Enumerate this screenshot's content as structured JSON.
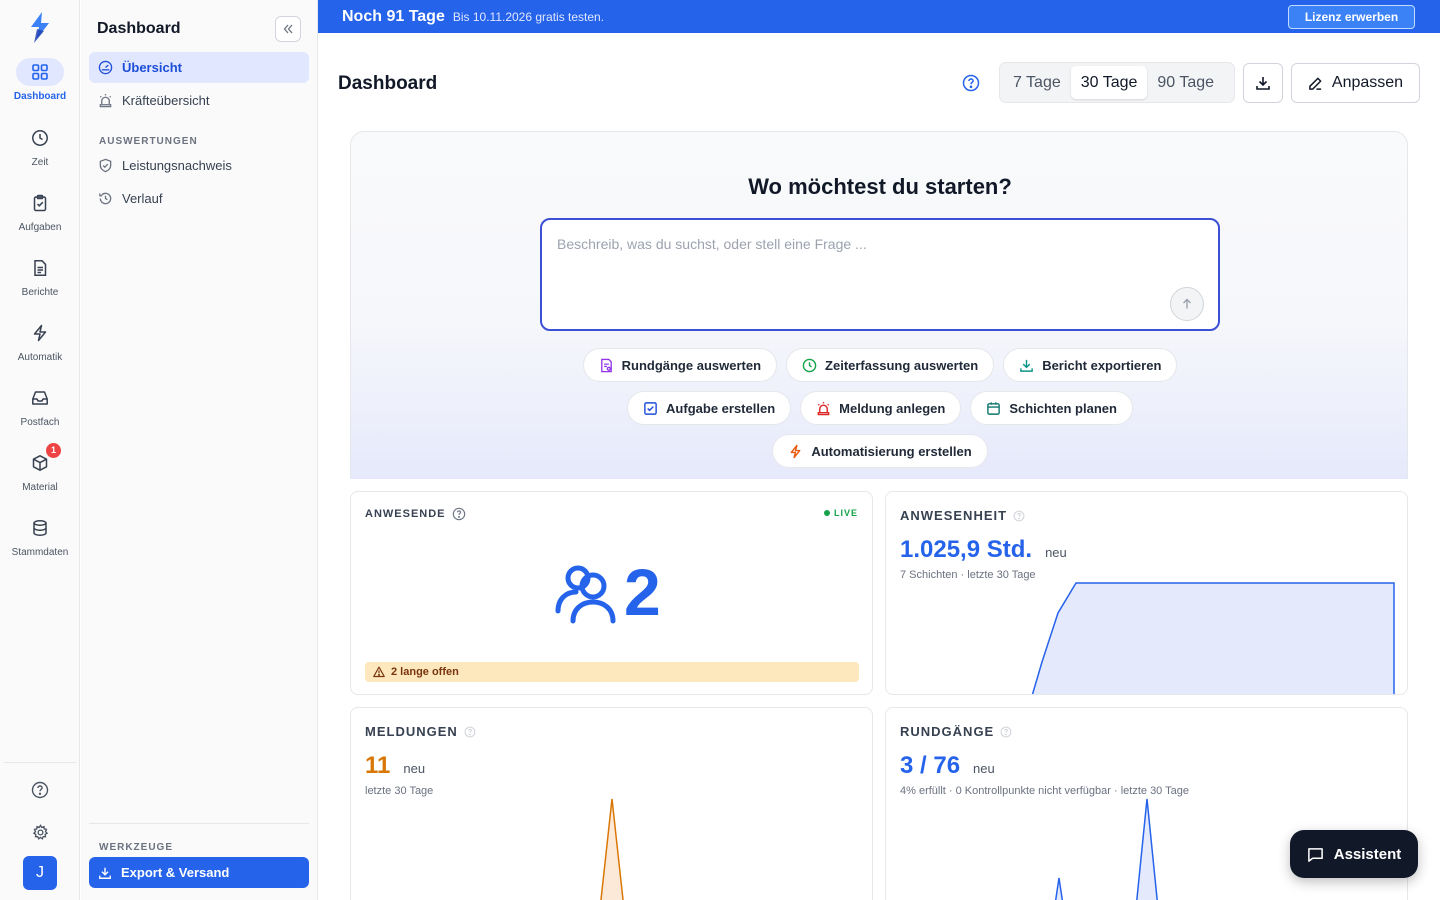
{
  "rail": {
    "items": [
      {
        "label": "Dashboard",
        "icon": "dashboard-grid-icon",
        "active": true
      },
      {
        "label": "Zeit",
        "icon": "clock-icon"
      },
      {
        "label": "Aufgaben",
        "icon": "clipboard-check-icon"
      },
      {
        "label": "Berichte",
        "icon": "document-icon"
      },
      {
        "label": "Automatik",
        "icon": "lightning-icon"
      },
      {
        "label": "Postfach",
        "icon": "inbox-icon"
      },
      {
        "label": "Material",
        "icon": "package-icon",
        "badge": "1"
      },
      {
        "label": "Stammdaten",
        "icon": "database-icon"
      }
    ],
    "avatar": "J"
  },
  "sidebar": {
    "title": "Dashboard",
    "items": [
      {
        "label": "Übersicht",
        "active": true
      },
      {
        "label": "Kräfteübersicht"
      }
    ],
    "section_auswertungen": "AUSWERTUNGEN",
    "auswertungen": [
      {
        "label": "Leistungsnachweis"
      },
      {
        "label": "Verlauf"
      }
    ],
    "section_werkzeuge": "WERKZEUGE",
    "export_label": "Export & Versand"
  },
  "banner": {
    "headline": "Noch 91 Tage",
    "subtext": "Bis 10.11.2026 gratis testen.",
    "button": "Lizenz erwerben"
  },
  "header": {
    "title": "Dashboard",
    "ranges": [
      "7 Tage",
      "30 Tage",
      "90 Tage"
    ],
    "active_range": "30 Tage",
    "customize": "Anpassen"
  },
  "hero": {
    "title": "Wo möchtest du starten?",
    "placeholder": "Beschreib, was du suchst, oder stell eine Frage ...",
    "chips": [
      [
        "Rundgänge auswerten",
        "Zeiterfassung auswerten",
        "Bericht exportieren"
      ],
      [
        "Aufgabe erstellen",
        "Meldung anlegen",
        "Schichten planen"
      ],
      [
        "Automatisierung erstellen"
      ]
    ]
  },
  "cards": {
    "anwesende": {
      "label": "ANWESENDE",
      "live": "LIVE",
      "count": "2",
      "warning": "2 lange offen"
    },
    "anwesenheit": {
      "label": "ANWESENHEIT",
      "value": "1.025,9 Std.",
      "tag": "neu",
      "subtitle": "7 Schichten · letzte 30 Tage"
    },
    "meldungen": {
      "label": "MELDUNGEN",
      "value": "11",
      "tag": "neu",
      "subtitle": "letzte 30 Tage"
    },
    "rundgaenge": {
      "label": "RUNDGÄNGE",
      "value": "3 / 76",
      "tag": "neu",
      "subtitle": "4% erfüllt · 0 Kontrollpunkte nicht verfügbar · letzte 30 Tage"
    }
  },
  "assistant": "Assistent",
  "colors": {
    "primary": "#2563eb",
    "accent_orange": "#d97706",
    "live_green": "#16a34a"
  }
}
